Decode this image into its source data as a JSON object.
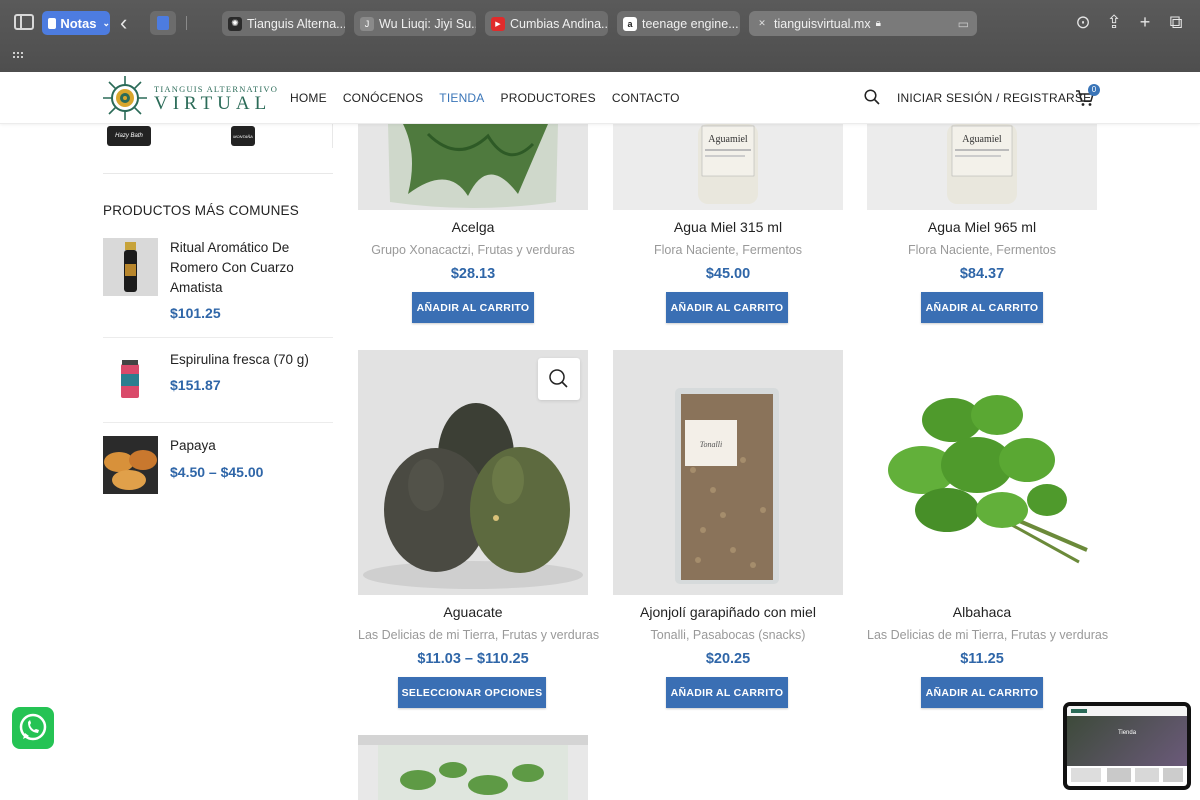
{
  "browser": {
    "notes_label": "Notas",
    "tabs": [
      {
        "title": "Tianguis Alterna...",
        "favicon_letter": "",
        "favicon_color": "#2b2b2b"
      },
      {
        "title": "Wu Liuqi: Jiyi Su...",
        "favicon_letter": "J",
        "favicon_color": "#7a7a7a"
      },
      {
        "title": "Cumbias Andina...",
        "favicon_letter": "▶",
        "favicon_color": "#e02b2b"
      },
      {
        "title": "teenage engine...",
        "favicon_letter": "a",
        "favicon_color": "#222222"
      },
      {
        "title": "tianguisvirtual.mx",
        "favicon_letter": "✕",
        "favicon_color": "#6e6e6e"
      }
    ]
  },
  "site": {
    "logo_small": "TIANGUIS ALTERNATIVO",
    "logo_big": "VIRTUAL",
    "nav": [
      "HOME",
      "CONÓCENOS",
      "TIENDA",
      "PRODUCTORES",
      "CONTACTO"
    ],
    "active_nav": "TIENDA",
    "login": "INICIAR SESIÓN / REGISTRARSE",
    "cart_count": "0",
    "accent": "#3a6fb4",
    "brand_green": "#2b6b58"
  },
  "sidebar": {
    "brand_logos": [
      "Hazy Bath",
      "MONTAÑA"
    ],
    "title": "PRODUCTOS MÁS COMUNES",
    "items": [
      {
        "name": "Ritual Aromático De Romero Con Cuarzo Amatista",
        "price": "$101.25"
      },
      {
        "name": "Espirulina fresca (70 g)",
        "price": "$151.87"
      },
      {
        "name": "Papaya",
        "price": "$4.50 – $45.00"
      }
    ]
  },
  "products": [
    {
      "name": "Acelga",
      "cats": [
        "Grupo Xonacactzi",
        "Frutas y verduras"
      ],
      "price": "$28.13",
      "button": "AÑADIR AL CARRITO"
    },
    {
      "name": "Agua Miel 315 ml",
      "cats": [
        "Flora Naciente",
        "Fermentos"
      ],
      "price": "$45.00",
      "button": "AÑADIR AL CARRITO",
      "label_text": "Aguamiel"
    },
    {
      "name": "Agua Miel 965 ml",
      "cats": [
        "Flora Naciente",
        "Fermentos"
      ],
      "price": "$84.37",
      "button": "AÑADIR AL CARRITO",
      "label_text": "Aguamiel"
    },
    {
      "name": "Aguacate",
      "cats": [
        "Las Delicias de mi Tierra",
        "Frutas y verduras"
      ],
      "price": "$11.03 – $110.25",
      "button": "SELECCIONAR OPCIONES"
    },
    {
      "name": "Ajonjolí garapiñado con miel",
      "cats": [
        "Tonalli",
        "Pasabocas (snacks)"
      ],
      "price": "$20.25",
      "button": "AÑADIR AL CARRITO",
      "label_text": "Tonalli"
    },
    {
      "name": "Albahaca",
      "cats": [
        "Las Delicias de mi Tierra",
        "Frutas y verduras"
      ],
      "price": "$11.25",
      "button": "AÑADIR AL CARRITO"
    }
  ],
  "preview": {
    "heading": "Tienda"
  }
}
